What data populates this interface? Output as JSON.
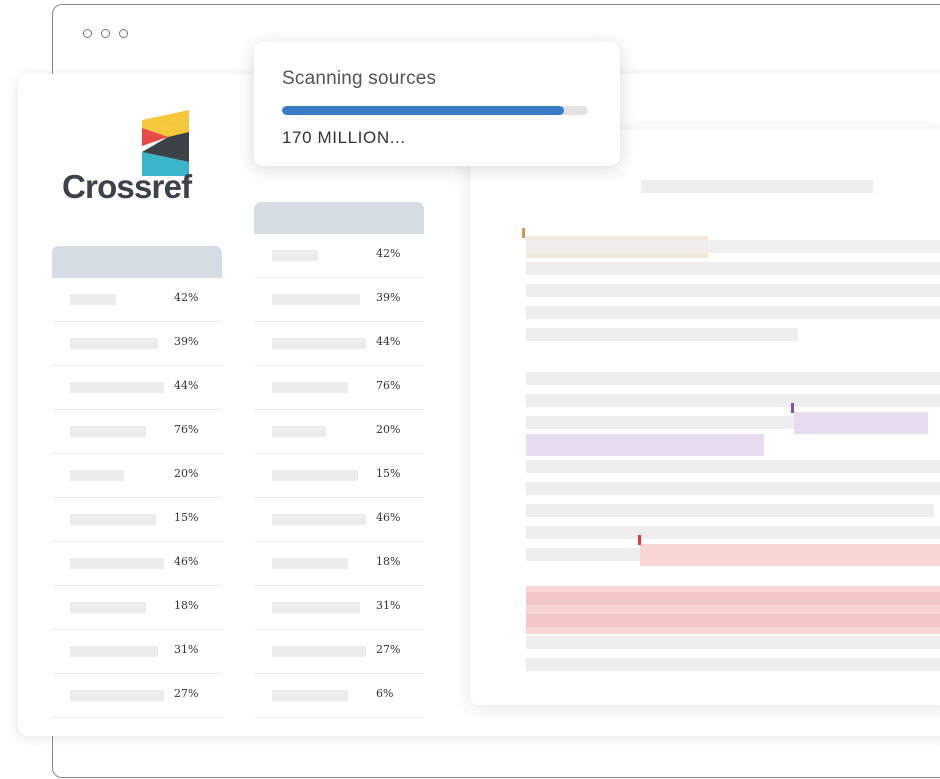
{
  "app": {
    "name": "Crossref"
  },
  "scan_popup": {
    "title": "Scanning sources",
    "progress": 0.92,
    "count_label": "170 MILLION...",
    "accent_color": "#3a7bc8"
  },
  "logo": {
    "colors": {
      "yellow": "#f5c73b",
      "red": "#e84a4b",
      "dark": "#3d4148",
      "teal": "#3ab5c9"
    }
  },
  "left_table": {
    "rows": [
      "42%",
      "39%",
      "44%",
      "76%",
      "20%",
      "15%",
      "46%",
      "18%",
      "31%",
      "27%"
    ]
  },
  "middle_table": {
    "rows": [
      "42%",
      "39%",
      "44%",
      "76%",
      "20%",
      "15%",
      "46%",
      "18%",
      "31%",
      "27%",
      "6%"
    ]
  },
  "highlights": {
    "tan": "#f3e8dc",
    "purple": "#eadcf0",
    "red": "#f8d6d6"
  }
}
